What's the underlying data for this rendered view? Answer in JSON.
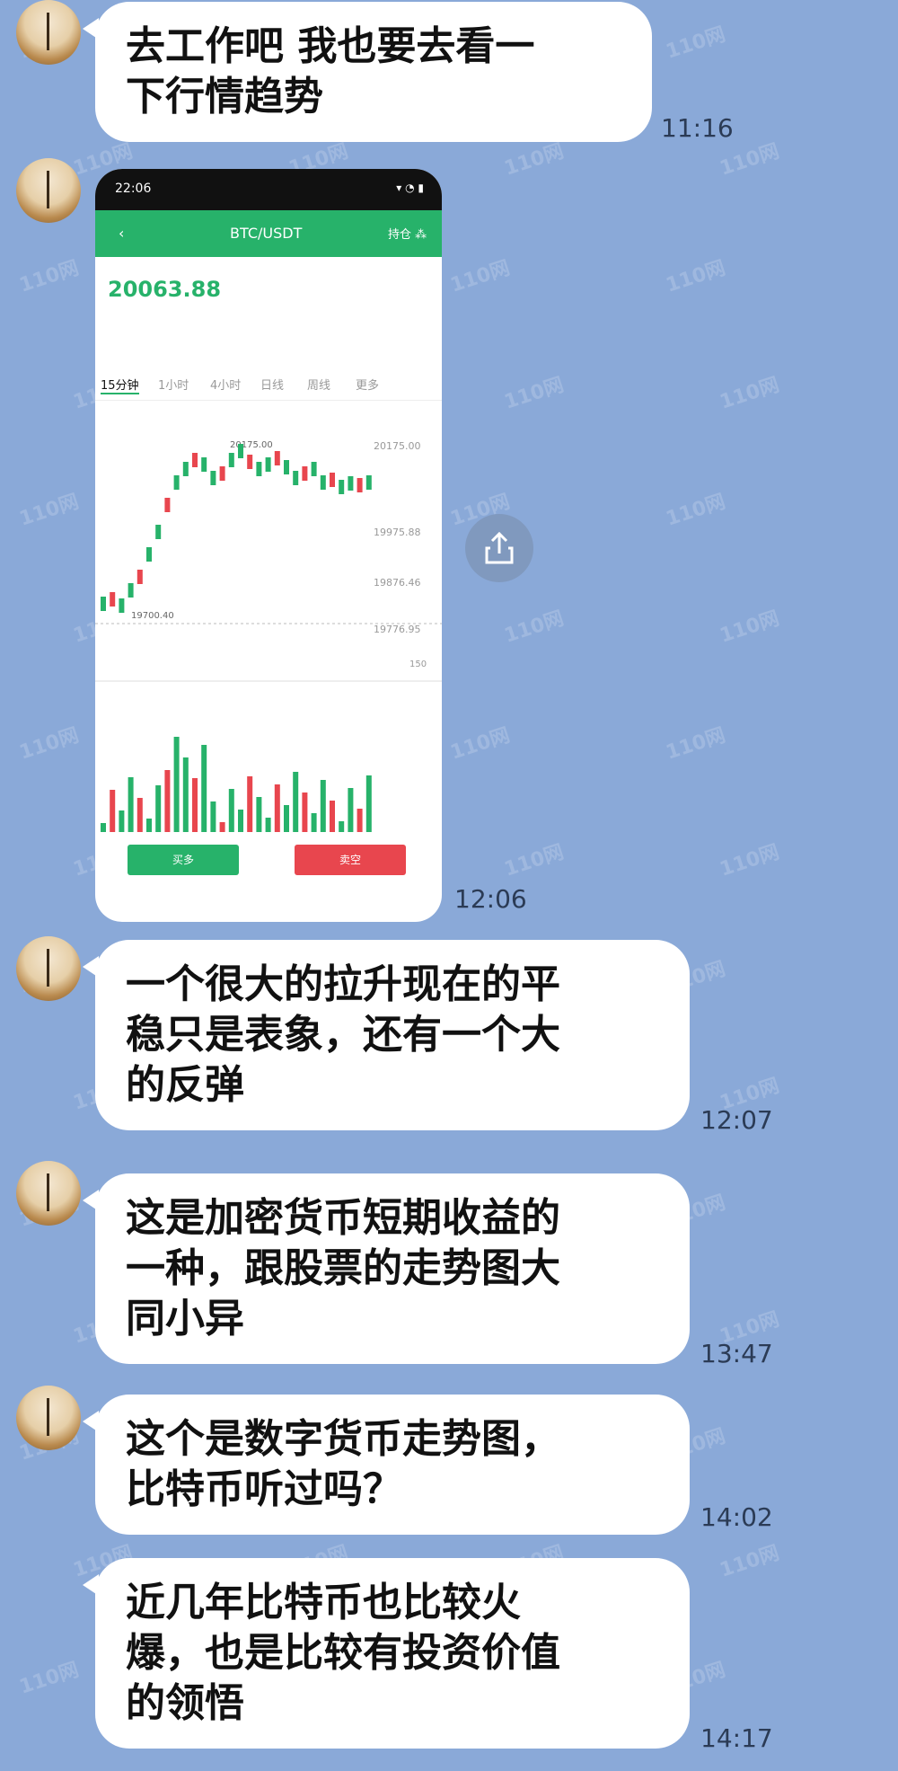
{
  "messages": [
    {
      "text": "去工作吧 我也要去看一下行情趋势",
      "time": "11:16"
    },
    {
      "time": "12:06"
    },
    {
      "text": "一个很大的拉升现在的平稳只是表象，还有一个大的反弹",
      "time": "12:07"
    },
    {
      "text": "这是加密货币短期收益的一种，跟股票的走势图大同小异",
      "time": "13:47"
    },
    {
      "text": "这个是数字货币走势图，比特币听过吗？",
      "time": "14:02"
    },
    {
      "text": "近几年比特币也比较火爆，也是比较有投资价值的领悟",
      "time": "14:17"
    }
  ],
  "phone": {
    "status_time": "22:06",
    "pair": "BTC/USDT",
    "price": "20063.88",
    "tabs": [
      "15分钟",
      "1小时",
      "4小时",
      "日线",
      "周线",
      "更多"
    ],
    "price_levels": [
      "20175.00",
      "19975.88",
      "19876.46",
      "19776.95"
    ],
    "high_mark": "20175.00",
    "low_mark": "19700.40",
    "vol_max": "150",
    "buy_label": "买多",
    "sell_label": "卖空"
  },
  "watermark": "110网",
  "colors": {
    "up": "#27b26a",
    "down": "#e8464e",
    "bg": "#8aa9d8"
  }
}
